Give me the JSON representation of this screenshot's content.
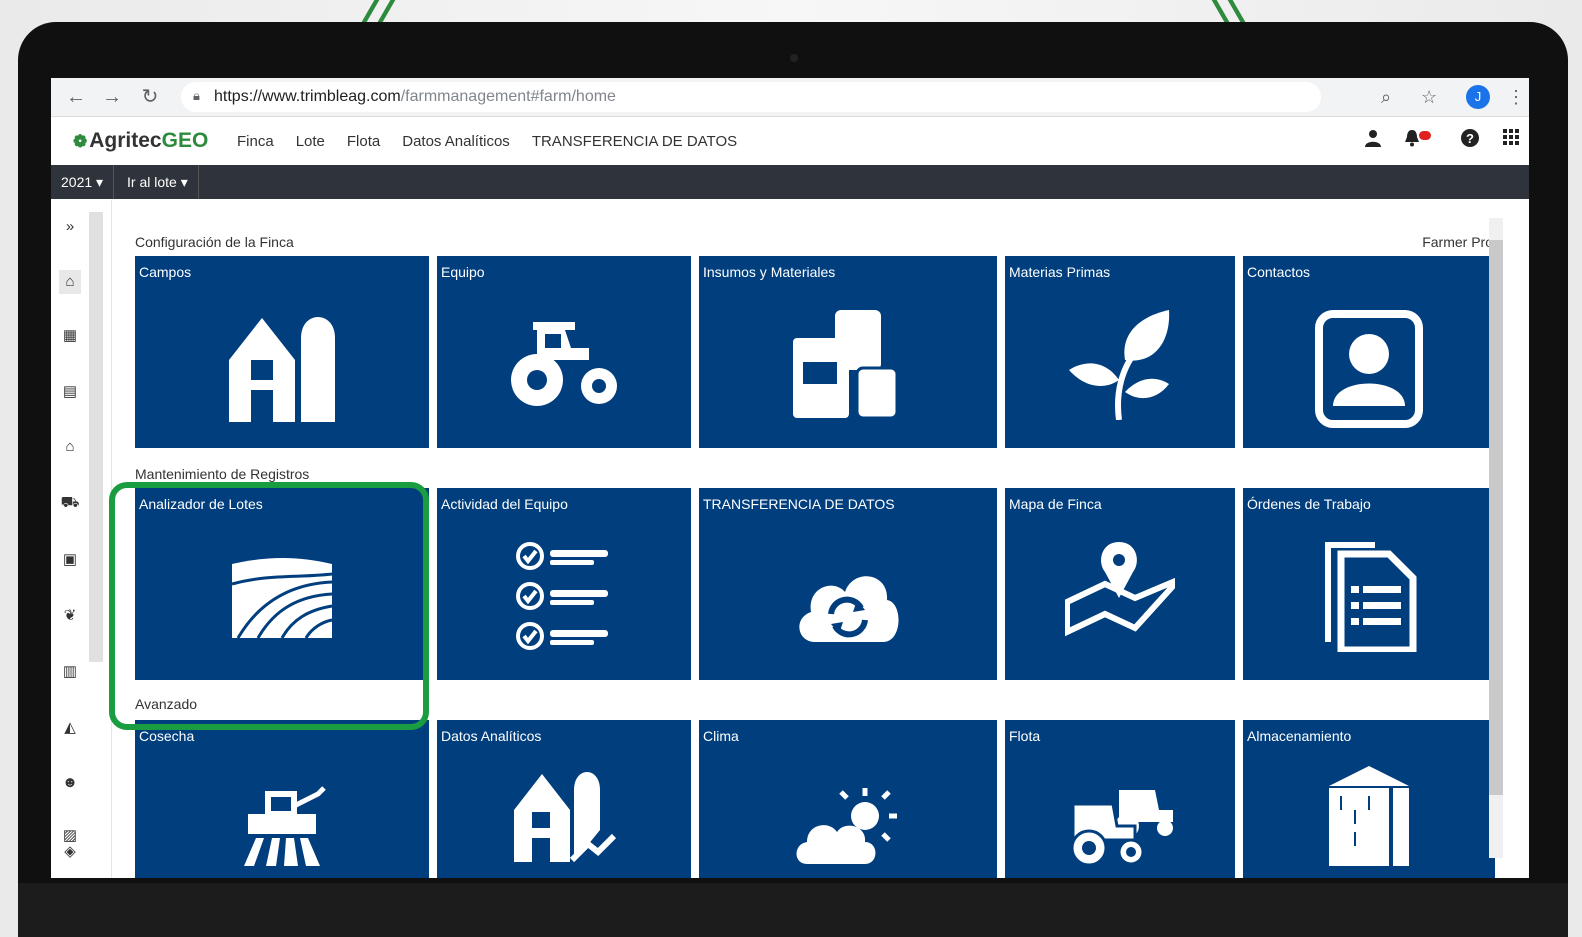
{
  "browser": {
    "url_host": "https://www.trimbleag.com",
    "url_path": "/farmmanagement#farm/home",
    "profile_initial": "J"
  },
  "app": {
    "logo_text": "Agritec",
    "logo_accent": "GEO",
    "nav": [
      "Finca",
      "Lote",
      "Flota",
      "Datos Analíticos",
      "TRANSFERENCIA DE DATOS"
    ]
  },
  "toolbar": {
    "year": "2021",
    "lot_selector": "Ir al lote"
  },
  "sections": {
    "config": "Configuración de la Finca",
    "records": "Mantenimiento de Registros",
    "advanced": "Avanzado",
    "plan": "Farmer Pro"
  },
  "tiles": {
    "row1": [
      "Campos",
      "Equipo",
      "Insumos y Materiales",
      "Materias Primas",
      "Contactos"
    ],
    "row2": [
      "Analizador de Lotes",
      "Actividad del Equipo",
      "TRANSFERENCIA DE DATOS",
      "Mapa de Finca",
      "Órdenes de Trabajo"
    ],
    "row3": [
      "Cosecha",
      "Datos Analíticos",
      "Clima",
      "Flota",
      "Almacenamiento"
    ]
  },
  "colors": {
    "tile_bg": "#003e7e",
    "highlight": "#1a9d41",
    "brand": "#2e8b3e"
  }
}
